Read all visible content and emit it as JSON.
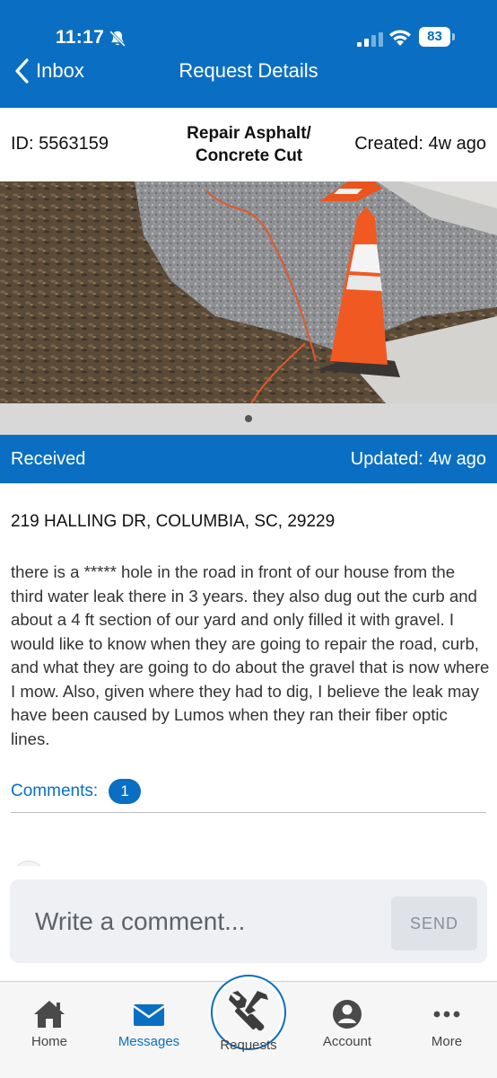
{
  "status_bar": {
    "time": "11:17",
    "battery": "83"
  },
  "nav": {
    "back_label": "Inbox",
    "title": "Request Details"
  },
  "request": {
    "id_text": "ID: 5563159",
    "title": "Repair Asphalt/ Concrete Cut",
    "created_text": "Created:  4w ago",
    "status": "Received",
    "updated_text": "Updated: 4w ago",
    "address": "219 HALLING DR, COLUMBIA, SC, 29229",
    "description": "there is a ***** hole in the road in front of our house from the third water leak there in 3 years. they also dug out the curb and about a 4 ft section of our yard and only filled it with gravel. I would like to know when they are going to repair the  road, curb, and what they are going to do about the gravel that is now where I mow. Also, given where they had to dig, I believe the leak may have been caused by Lumos when they ran their fiber optic lines."
  },
  "photo": {
    "page_count": 1,
    "current_page": 1
  },
  "comments": {
    "label": "Comments:",
    "count": "1"
  },
  "composer": {
    "placeholder": "Write a comment...",
    "send_label": "SEND"
  },
  "tabs": [
    {
      "label": "Home",
      "icon": "home-icon"
    },
    {
      "label": "Messages",
      "icon": "envelope-icon",
      "active": true
    },
    {
      "label": "Requests",
      "icon": "tools-icon"
    },
    {
      "label": "Account",
      "icon": "user-icon"
    },
    {
      "label": "More",
      "icon": "more-icon"
    }
  ],
  "colors": {
    "primary": "#0a6fc2",
    "pager_bg": "#d8d8d8",
    "composer_bg": "#eef0f3"
  }
}
